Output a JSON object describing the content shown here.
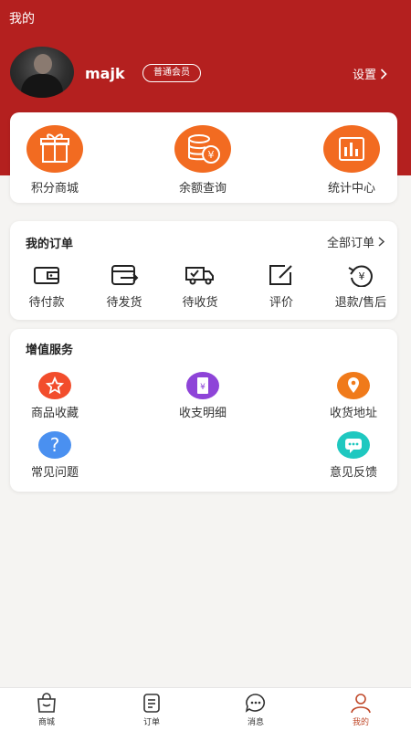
{
  "header": {
    "title": "我的"
  },
  "profile": {
    "username": "majk",
    "member_level": "普通会员",
    "settings_label": "设置"
  },
  "quick_actions": [
    {
      "label": "积分商城",
      "icon": "gift-icon"
    },
    {
      "label": "余额查询",
      "icon": "coins-icon"
    },
    {
      "label": "统计中心",
      "icon": "bar-chart-icon"
    }
  ],
  "orders": {
    "title": "我的订单",
    "all_label": "全部订单",
    "items": [
      {
        "label": "待付款",
        "icon": "wallet-icon"
      },
      {
        "label": "待发货",
        "icon": "ship-box-icon"
      },
      {
        "label": "待收货",
        "icon": "truck-icon"
      },
      {
        "label": "评价",
        "icon": "edit-icon"
      },
      {
        "label": "退款/售后",
        "icon": "refund-icon"
      }
    ]
  },
  "services": {
    "title": "增值服务",
    "items": [
      {
        "label": "商品收藏",
        "icon": "star-icon",
        "color": "#f24d2c"
      },
      {
        "label": "收支明细",
        "icon": "receipt-icon",
        "color": "#8e44d8"
      },
      {
        "label": "收货地址",
        "icon": "location-icon",
        "color": "#f07a1a"
      },
      {
        "label": "常见问题",
        "icon": "question-icon",
        "color": "#4a90f0"
      },
      {
        "label": "意见反馈",
        "icon": "chat-bubble-icon",
        "color": "#1fc8c0"
      }
    ]
  },
  "tabbar": {
    "items": [
      {
        "label": "商城",
        "icon": "shop-bag-icon"
      },
      {
        "label": "订单",
        "icon": "order-list-icon"
      },
      {
        "label": "消息",
        "icon": "message-icon"
      },
      {
        "label": "我的",
        "icon": "person-icon",
        "active": true
      }
    ]
  },
  "colors": {
    "brand": "#b4201f",
    "accent": "#f26b21",
    "active_tab": "#c0492a"
  }
}
